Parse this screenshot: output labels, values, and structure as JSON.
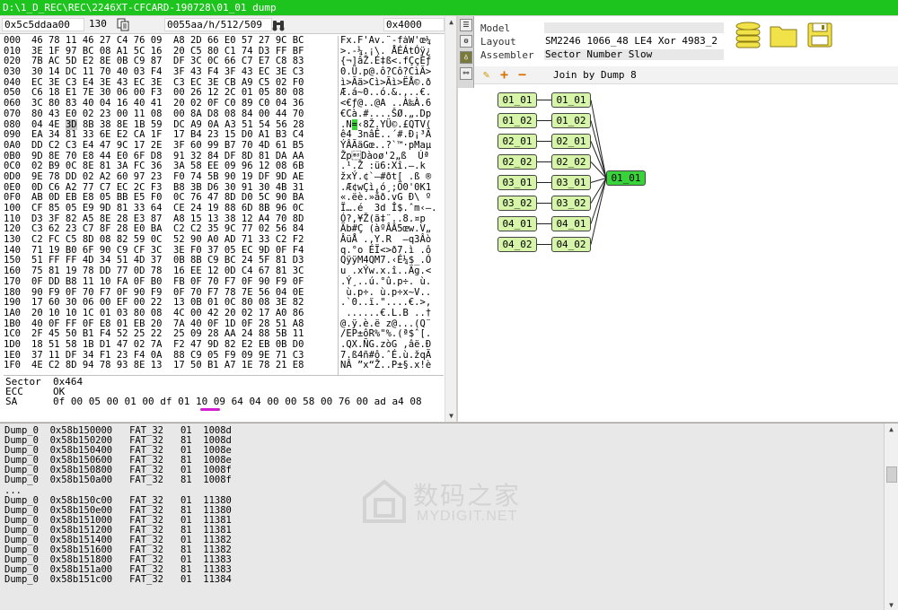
{
  "window": {
    "title": "D:\\1_D_REC\\REC\\2246XT-CFCARD-190728\\01_01 dump",
    "accent_color": "#1ec41e"
  },
  "toolbar": {
    "address": "0x5c5ddaa00",
    "count": "130",
    "geometry": "0055aa/h/512/509",
    "size": "0x4000",
    "copy_icon": "copy-icon",
    "search_icon": "binoculars-icon"
  },
  "hex": {
    "offsets": [
      "000",
      "010",
      "020",
      "030",
      "040",
      "050",
      "060",
      "070",
      "080",
      "090",
      "0A0",
      "0B0",
      "0C0",
      "0D0",
      "0E0",
      "0F0",
      "100",
      "110",
      "120",
      "130",
      "140",
      "150",
      "160",
      "170",
      "180",
      "190",
      "1A0",
      "1B0",
      "1C0",
      "1D0",
      "1E0",
      "1F0"
    ],
    "rows": [
      "46 78 11 46 27 C4 76 09  A8 2D 66 E0 57 27 9C BC",
      "3E 1F 97 BC 08 A1 5C 16  20 C5 80 C1 74 D3 FF BF",
      "7B AC 5D E2 8E 0B C9 87  DF 3C 0C 66 C7 E7 C8 83",
      "30 14 DC 11 70 40 03 F4  3F 43 F4 3F 43 EC 3E C3",
      "EC 3E C3 E4 3E 43 EC 3E  C3 EC 3E CB A9 C5 02 F0",
      "C6 18 E1 7E 30 06 00 F3  00 26 12 2C 01 05 80 08",
      "3C 80 83 40 04 16 40 41  20 02 0F C0 89 C0 04 36",
      "80 43 E0 02 23 00 11 08  00 8A D8 08 84 00 44 70",
      "04 4E 3D 8B 38 8E 1B 59  DC A9 0A A3 51 54 56 28",
      "EA 34 81 33 6E E2 CA 1F  17 B4 23 15 D0 A1 B3 C4",
      "DD C2 C3 E4 47 9C 17 2E  3F 60 99 B7 70 4D 61 B5",
      "9D 8E 70 E8 44 E0 6F D8  91 32 84 DF 8D 81 DA AA",
      "02 B9 0C 8E 81 3A FC 36  3A 58 EE 09 96 12 08 6B",
      "9E 78 DD 02 A2 60 97 23  F0 74 5B 90 19 DF 9D AE",
      "0D C6 A2 77 C7 EC 2C F3  B8 3B D6 30 91 30 4B 31",
      "AB 0D EB E8 05 BB E5 F0  0C 76 47 8D D0 5C 90 BA",
      "CF 85 05 E9 9D 81 33 64  CE 24 19 88 6D 8B 96 0C",
      "D3 3F 82 A5 8E 28 E3 87  A8 15 13 38 12 A4 70 8D",
      "C3 62 23 C7 8F 28 E0 BA  C2 C2 35 9C 77 02 56 84",
      "C2 FC C5 8D 08 82 59 0C  52 90 A0 AD 71 33 C2 F2",
      "71 19 B0 6F 90 C9 CF 3C  3E F0 37 05 EC 9D 0F F4",
      "51 FF FF 4D 34 51 4D 37  0B 8B C9 BC 24 5F 81 D3",
      "75 81 19 78 DD 77 0D 78  16 EE 12 0D C4 67 81 3C",
      "0F DD B8 11 10 FA 0F B0  FB 0F 70 F7 0F 90 F9 0F",
      "90 F9 0F 70 F7 0F 90 F9  0F 70 F7 78 7E 56 04 0E",
      "17 60 30 06 00 EF 00 22  13 0B 01 0C 80 08 3E 82",
      "20 10 10 1C 01 03 80 08  4C 00 42 20 02 17 A0 86",
      "40 0F FF 0F E8 01 EB 20  7A 40 0F 1D 0F 28 51 A8",
      "2F 45 50 B1 F4 52 25 22  25 09 28 AA 24 88 5B 11",
      "18 51 58 1B D1 47 02 7A  F2 47 9D 82 E2 EB 0B D0",
      "37 11 DF 34 F1 23 F4 0A  88 C9 05 F9 09 9E 71 C3",
      "4E C2 8D 94 78 93 8E 13  17 50 B1 A7 1E 78 21 E8"
    ],
    "ascii": [
      "Fx.F'Äv.¨-fàW'œ¼",
      ">.-¼.¡\\. ÅÉÁtÓÿ¿",
      "{¬]âŽ.É‡ß<.fÇçÈƒ",
      "0.Ü.p@.ô?Cô?CìÃ>",
      "ì>Ãä>Cì>Ãì>ËÅ©.ð",
      "Æ.á~0..ó.&.,..€.",
      "<€ƒ@..@A ..À‰À.6",
      "€Cà.#....ŠØ.„.Dp",
      ".N=‹8Ž.YÜ©.£QTV(",
      "ê4 3nâÊ..´#.Ð¡³Ä",
      "ÝÂÃäGœ..?`™·pMaµ",
      "Žp\bDàoø'2„ß  Úª",
      ".¹.Ž :ü6:Xî.–.k",
      "žxÝ.¢`—#ðt[ .ß ®",
      ".Æ¢wÇì,ó¸;Ö0'0K1",
      "«.ëè.»åð.vG Ð\\ º",
      "Ï….é  3d Î$.ˆm‹–.",
      "Ó?‚¥Ž(ã‡¨..8.¤p",
      "Ãb#Ç (àºÂÂ5œw.V„",
      "ÂüÅ .‚Y.R  –q3Âò",
      "q.°o ÉÏ<>ð7.ì .ô",
      "QÿÿM4QM7.‹É¼$_.Ó",
      "u .xÝw.x.î..Äg.<",
      ".Ý¸..ú.°û.p÷. ù.",
      " ù.p÷. ù.p÷x~V..",
      ".`0..ï.\"....€.>‚",
      " ......€.L.B ..†",
      "@.ÿ.è.ë z@...(Q¨",
      "/EP±ôR%\"%.(ª$ˆ[.",
      ".QX.ÑG.zòG ‚âë.Ð",
      "7.ß4ñ#ô.ˆÉ.ù.žqÃ",
      "NÂ ”x“Ž..P±§.x!è"
    ]
  },
  "info": {
    "sector_label": "Sector",
    "sector_value": "0x464",
    "ecc_label": "ECC",
    "ecc_value": "OK",
    "sa_label": "SA",
    "sa_value": "0f 00 05 00 01 00 df 01 10 09 64 04 00 00 58 00 76 00 ad a4 08"
  },
  "properties": {
    "model_label": "Model",
    "model_value": "",
    "layout_label": "Layout",
    "layout_value": "SM2246 1066_48 LE4 Xor 4983_2",
    "assembler_label": "Assembler",
    "assembler_value": "Sector Number Slow"
  },
  "graph": {
    "toolbar_label": "Join by Dump 8",
    "left_nodes": [
      "01_01",
      "01_02",
      "02_01",
      "02_02",
      "03_01",
      "03_02",
      "04_01",
      "04_02"
    ],
    "mid_nodes": [
      "01_01",
      "01_02",
      "02_01",
      "02_02",
      "03_01",
      "03_02",
      "04_01",
      "04_02"
    ],
    "join_node": "01_01",
    "node_color": "#d6f5a8",
    "join_color": "#3ad23a"
  },
  "log": {
    "lines": [
      "Dump_0  0x58b150000   FAT_32   01  1008d",
      "Dump_0  0x58b150200   FAT_32   81  1008d",
      "Dump_0  0x58b150400   FAT_32   01  1008e",
      "Dump_0  0x58b150600   FAT_32   81  1008e",
      "Dump_0  0x58b150800   FAT_32   01  1008f",
      "Dump_0  0x58b150a00   FAT_32   81  1008f",
      "...",
      "Dump_0  0x58b150c00   FAT_32   01  11380",
      "Dump_0  0x58b150e00   FAT_32   81  11380",
      "Dump_0  0x58b151000   FAT_32   01  11381",
      "Dump_0  0x58b151200   FAT_32   81  11381",
      "Dump_0  0x58b151400   FAT_32   01  11382",
      "Dump_0  0x58b151600   FAT_32   81  11382",
      "Dump_0  0x58b151800   FAT_32   01  11383",
      "Dump_0  0x58b151a00   FAT_32   81  11383",
      "Dump_0  0x58b151c00   FAT_32   01  11384"
    ]
  },
  "watermark": {
    "cn": "数码之家",
    "en": "MYDIGIT.NET"
  }
}
